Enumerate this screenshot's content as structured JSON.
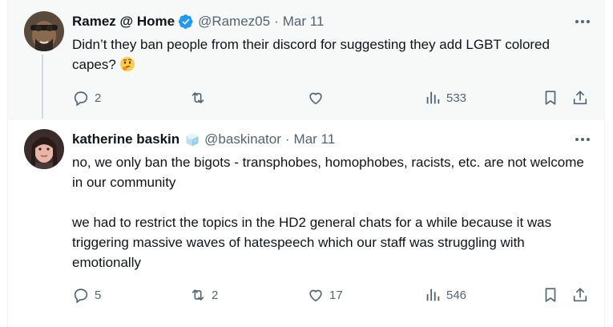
{
  "tweets": [
    {
      "author": "Ramez @ Home",
      "verified": true,
      "handle": "@Ramez05",
      "separator": "·",
      "date": "Mar 11",
      "text_lines": [
        "Didn’t they ban people from their discord for suggesting they add LGBT colored capes?"
      ],
      "emoji": "thinking-face",
      "replies": "2",
      "reposts": "",
      "likes": "",
      "views": "533",
      "background": "#f7f9f9"
    },
    {
      "author": "katherine baskin",
      "badge_emoji": "ice-cube",
      "handle": "@baskinator",
      "separator": "·",
      "date": "Mar 11",
      "paragraphs": [
        "no, we only ban the bigots - transphobes, homophobes, racists, etc. are not welcome in our community",
        "we had to restrict the topics in the HD2 general chats for a while because it was triggering massive waves of hatespeech which our staff was struggling with emotionally"
      ],
      "replies": "5",
      "reposts": "2",
      "likes": "17",
      "views": "546",
      "background": "#ffffff"
    }
  ],
  "colors": {
    "text": "#0f1419",
    "secondary": "#536471",
    "verified_blue": "#1d9bf0",
    "hover_bg": "#f7f9f9",
    "divider": "#eff3f4"
  }
}
